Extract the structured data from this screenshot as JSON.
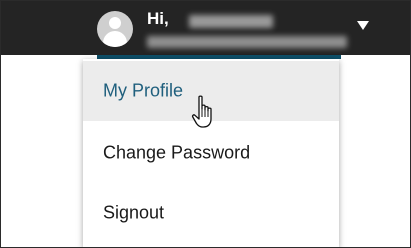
{
  "header": {
    "greeting": "Hi,",
    "user_name_redacted": "",
    "user_org_redacted": ""
  },
  "menu": {
    "items": [
      {
        "label": "My Profile",
        "state": "hover"
      },
      {
        "label": "Change Password"
      },
      {
        "label": "Signout"
      }
    ]
  },
  "colors": {
    "topbar_bg": "#242424",
    "accent": "#0e4f68",
    "hover_bg": "#ececec",
    "hover_text": "#1f5f7d"
  },
  "icons": {
    "avatar": "user-avatar-icon",
    "caret": "caret-down-icon",
    "cursor": "hand-pointer-icon"
  }
}
